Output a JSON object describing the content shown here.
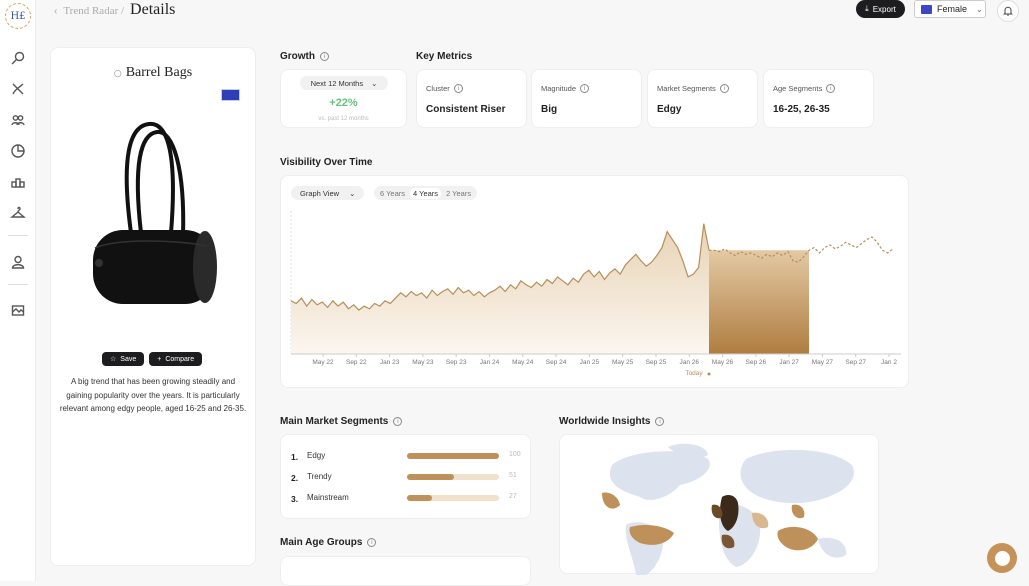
{
  "app": {
    "logo_text": "H£"
  },
  "breadcrumb": {
    "previous": "Trend Radar /",
    "current": "Details"
  },
  "header": {
    "export_label": "Export",
    "gender_value": "Female"
  },
  "sidebar": {
    "items": [
      {
        "icon": "search-icon"
      },
      {
        "icon": "trend-icon"
      },
      {
        "icon": "people-icon"
      },
      {
        "icon": "pie-chart-icon"
      },
      {
        "icon": "blocks-icon"
      },
      {
        "icon": "hanger-icon"
      },
      {
        "icon": "user-icon"
      },
      {
        "icon": "catalog-icon"
      }
    ]
  },
  "product": {
    "title": "Barrel Bags",
    "save_label": "Save",
    "compare_label": "Compare",
    "description": "A big trend that has been growing steadily and gaining popularity over the years. It is particularly relevant among edgy people, aged 16-25 and 26-35."
  },
  "growth": {
    "title": "Growth",
    "period": "Next 12 Months",
    "value": "+22%",
    "sub": "vs. past 12 months",
    "value_color": "#6abf7f"
  },
  "key_metrics": {
    "title": "Key Metrics",
    "items": [
      {
        "label": "Cluster",
        "value": "Consistent Riser"
      },
      {
        "label": "Magnitude",
        "value": "Big"
      },
      {
        "label": "Market Segments",
        "value": "Edgy"
      },
      {
        "label": "Age Segments",
        "value": "16-25, 26-35"
      }
    ]
  },
  "visibility": {
    "title": "Visibility Over Time",
    "view": "Graph View",
    "ranges": [
      "6 Years",
      "4 Years",
      "2 Years"
    ],
    "active_range": "4 Years",
    "today_label": "Today"
  },
  "chart_data": {
    "type": "area",
    "x_labels": [
      "May 22",
      "Sep 22",
      "Jan 23",
      "May 23",
      "Sep 23",
      "Jan 24",
      "May 24",
      "Sep 24",
      "Jan 25",
      "May 25",
      "Sep 25",
      "Jan 26",
      "May 26",
      "Sep 26",
      "Jan 27",
      "May 27",
      "Sep 27",
      "Jan 2"
    ],
    "series": [
      {
        "name": "",
        "values": [
          0.4,
          0.38,
          0.42,
          0.36,
          0.41,
          0.37,
          0.39,
          0.35,
          0.4,
          0.36,
          0.39,
          0.34,
          0.37,
          0.33,
          0.36,
          0.34,
          0.38,
          0.36,
          0.4,
          0.38,
          0.42,
          0.46,
          0.43,
          0.47,
          0.44,
          0.46,
          0.42,
          0.48,
          0.44,
          0.47,
          0.49,
          0.45,
          0.5,
          0.46,
          0.48,
          0.44,
          0.47,
          0.43,
          0.46,
          0.48,
          0.51,
          0.47,
          0.52,
          0.49,
          0.55,
          0.52,
          0.5,
          0.54,
          0.51,
          0.56,
          0.53,
          0.58,
          0.55,
          0.52,
          0.57,
          0.54,
          0.6,
          0.63,
          0.58,
          0.62,
          0.56,
          0.61,
          0.64,
          0.6,
          0.67,
          0.71,
          0.75,
          0.7,
          0.66,
          0.69,
          0.74,
          0.8,
          0.92,
          0.86,
          0.8,
          0.7,
          0.58,
          0.6,
          0.65,
          0.98,
          0.78
        ]
      },
      {
        "name": "",
        "values": [
          0.78,
          0.78,
          0.77,
          0.79,
          0.76,
          0.74,
          0.77,
          0.75,
          0.76,
          0.74,
          0.72,
          0.75,
          0.73,
          0.76,
          0.74,
          0.77,
          0.7,
          0.69,
          0.73,
          0.78,
          0.8,
          0.76,
          0.8,
          0.82,
          0.79,
          0.81,
          0.84,
          0.82,
          0.8,
          0.83,
          0.86,
          0.88,
          0.84,
          0.78,
          0.76,
          0.79
        ]
      }
    ],
    "forecast_band": true,
    "ylim": [
      0,
      1
    ],
    "colors": {
      "line": "#b68e5a",
      "band": "#b98647"
    }
  },
  "segments": {
    "title": "Main Market Segments",
    "items": [
      {
        "rank": "1.",
        "name": "Edgy",
        "value": "100",
        "fraction": 1.0
      },
      {
        "rank": "2.",
        "name": "Trendy",
        "value": "51",
        "fraction": 0.51
      },
      {
        "rank": "3.",
        "name": "Mainstream",
        "value": "27",
        "fraction": 0.27
      }
    ]
  },
  "world": {
    "title": "Worldwide Insights"
  },
  "age_groups": {
    "title": "Main Age Groups"
  }
}
